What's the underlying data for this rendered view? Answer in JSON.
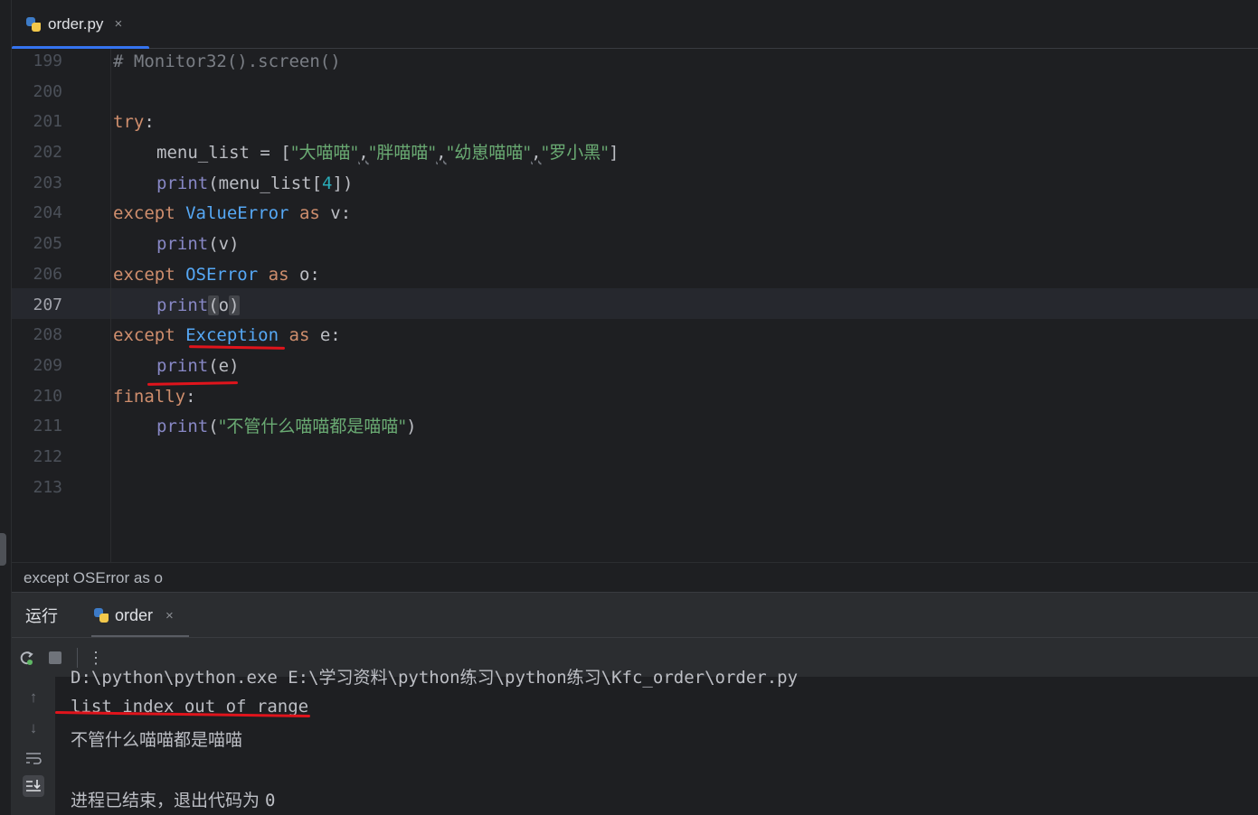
{
  "editor_tab": {
    "label": "order.py",
    "close": "×",
    "icon": "python-file-icon"
  },
  "code": {
    "line_numbers": [
      "199",
      "200",
      "201",
      "202",
      "203",
      "204",
      "205",
      "206",
      "207",
      "208",
      "209",
      "210",
      "211",
      "212",
      "213"
    ],
    "active_line": "207",
    "l199": "# Monitor32().screen()",
    "l201_kw": "try",
    "l201_rest": ":",
    "l202_a": "menu_list = [",
    "l202_s1": "\"大喵喵\"",
    "l202_c": ",",
    "l202_s2": "\"胖喵喵\"",
    "l202_s3": "\"幼崽喵喵\"",
    "l202_s4": "\"罗小黑\"",
    "l202_end": "]",
    "print": "print",
    "l203_a": "(menu_list[",
    "l203_num": "4",
    "l203_b": "])",
    "except": "except",
    "as": "as",
    "l204_cls": "ValueError",
    "l204_var": " v:",
    "l205_arg": "(v)",
    "l206_cls": "OSError",
    "l206_var": " o:",
    "l207_open": "(",
    "l207_arg": "o",
    "l207_close": ")",
    "l208_cls": "Exception",
    "l208_var": " e:",
    "l209_arg": "(e)",
    "l210_kw": "finally",
    "l210_rest": ":",
    "l211_open": "(",
    "l211_str": "\"不管什么喵喵都是喵喵\"",
    "l211_close": ")"
  },
  "breadcrumb": "except OSError as o",
  "run_panel": {
    "title": "运行",
    "tab_label": "order",
    "tab_close": "×",
    "toolbar": {
      "rerun_icon": "rerun-icon",
      "stop_icon": "stop-icon",
      "more": "⋮"
    },
    "side_icons": [
      "arrow-up-icon",
      "arrow-down-icon",
      "soft-wrap-icon",
      "scroll-to-end-icon"
    ],
    "console": {
      "command": "D:\\python\\python.exe E:\\学习资料\\python练习\\python练习\\Kfc_order\\order.py",
      "line1": "list index out of range",
      "line2": "不管什么喵喵都是喵喵",
      "line3": "",
      "line4_text": "进程已结束，退出代码为 ",
      "line4_code": "0"
    }
  },
  "colors": {
    "annotation": "#e0141c",
    "keyword": "#cf8e6d",
    "builtin": "#8888c6",
    "class": "#56a8f5",
    "string": "#6aab73",
    "number": "#2aacb8",
    "tab_accent": "#3574f0"
  }
}
